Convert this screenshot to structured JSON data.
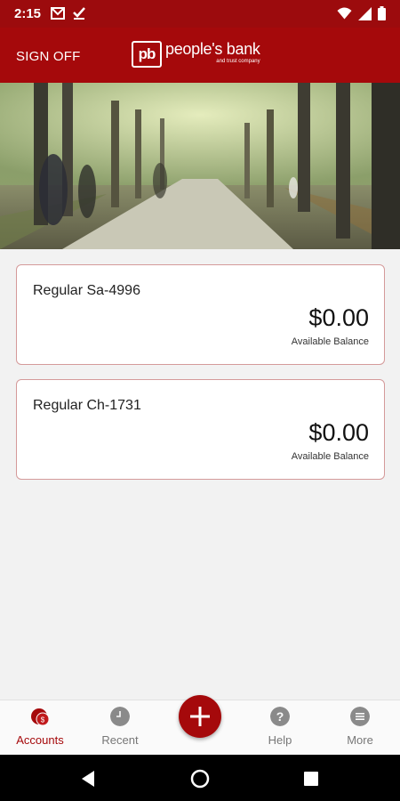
{
  "status_bar": {
    "time": "2:15",
    "left_icons": [
      "gmail-icon",
      "checkmark-icon"
    ],
    "right_icons": [
      "wifi-icon",
      "signal-icon",
      "battery-icon"
    ]
  },
  "header": {
    "sign_off_label": "SIGN OFF",
    "logo_mark": "pb",
    "logo_name": "people's bank",
    "logo_subtitle": "and trust company",
    "background_color": "#a5090b"
  },
  "hero": {
    "icon": "park-path-photo"
  },
  "accounts": [
    {
      "name": "Regular Sa-4996",
      "balance": "$0.00",
      "balance_label": "Available Balance"
    },
    {
      "name": "Regular Ch-1731",
      "balance": "$0.00",
      "balance_label": "Available Balance"
    }
  ],
  "bottom_nav": {
    "items": [
      {
        "label": "Accounts",
        "icon": "accounts-icon",
        "active": true
      },
      {
        "label": "Recent",
        "icon": "clock-icon",
        "active": false
      },
      {
        "label": "Help",
        "icon": "help-icon",
        "active": false
      },
      {
        "label": "More",
        "icon": "menu-icon",
        "active": false
      }
    ],
    "fab_icon": "plus-icon"
  },
  "android_nav": {
    "icons": [
      "back-icon",
      "home-icon",
      "recents-icon"
    ]
  }
}
